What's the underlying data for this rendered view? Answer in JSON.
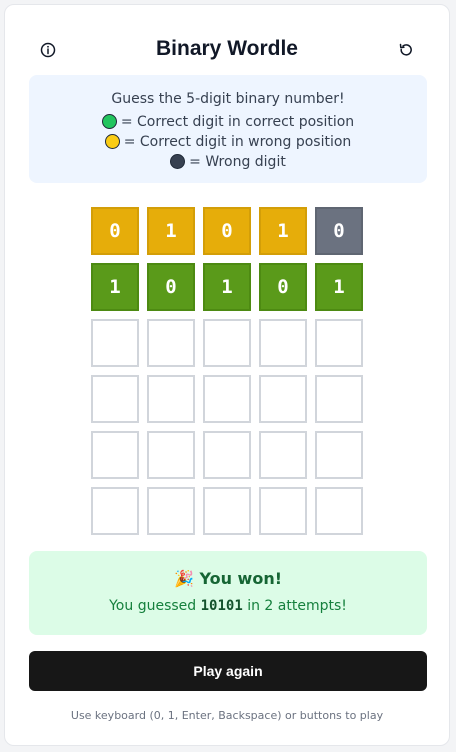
{
  "header": {
    "title": "Binary Wordle",
    "info_icon": "info-icon",
    "reset_icon": "reset-icon"
  },
  "instructions": {
    "intro": "Guess the 5-digit binary number!",
    "legend": [
      {
        "color": "#22c55e",
        "text": "= Correct digit in correct position"
      },
      {
        "color": "#facc15",
        "text": "= Correct digit in wrong position"
      },
      {
        "color": "#374151",
        "text": "= Wrong digit"
      }
    ]
  },
  "board": {
    "rows": [
      [
        {
          "value": "0",
          "state": "yellow"
        },
        {
          "value": "1",
          "state": "yellow"
        },
        {
          "value": "0",
          "state": "yellow"
        },
        {
          "value": "1",
          "state": "yellow"
        },
        {
          "value": "0",
          "state": "gray"
        }
      ],
      [
        {
          "value": "1",
          "state": "green"
        },
        {
          "value": "0",
          "state": "green"
        },
        {
          "value": "1",
          "state": "green"
        },
        {
          "value": "0",
          "state": "green"
        },
        {
          "value": "1",
          "state": "green"
        }
      ],
      [
        {
          "value": "",
          "state": "empty"
        },
        {
          "value": "",
          "state": "empty"
        },
        {
          "value": "",
          "state": "empty"
        },
        {
          "value": "",
          "state": "empty"
        },
        {
          "value": "",
          "state": "empty"
        }
      ],
      [
        {
          "value": "",
          "state": "empty"
        },
        {
          "value": "",
          "state": "empty"
        },
        {
          "value": "",
          "state": "empty"
        },
        {
          "value": "",
          "state": "empty"
        },
        {
          "value": "",
          "state": "empty"
        }
      ],
      [
        {
          "value": "",
          "state": "empty"
        },
        {
          "value": "",
          "state": "empty"
        },
        {
          "value": "",
          "state": "empty"
        },
        {
          "value": "",
          "state": "empty"
        },
        {
          "value": "",
          "state": "empty"
        }
      ],
      [
        {
          "value": "",
          "state": "empty"
        },
        {
          "value": "",
          "state": "empty"
        },
        {
          "value": "",
          "state": "empty"
        },
        {
          "value": "",
          "state": "empty"
        },
        {
          "value": "",
          "state": "empty"
        }
      ]
    ]
  },
  "result": {
    "emoji": "🎉",
    "headline": "You won!",
    "sub_before": "You guessed",
    "guess": "10101",
    "sub_after": "in 2 attempts!"
  },
  "play_again_label": "Play again",
  "hint": "Use keyboard (0, 1, Enter, Backspace) or buttons to play"
}
